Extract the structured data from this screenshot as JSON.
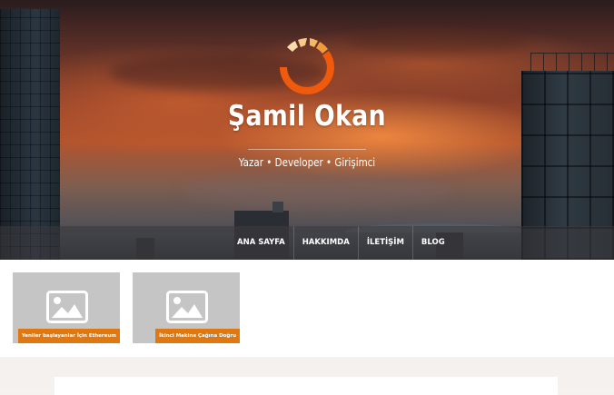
{
  "site": {
    "title": "Şamil Okan",
    "tagline": "Yazar • Developer • Girişimci"
  },
  "nav": {
    "items": [
      {
        "label": "ANA SAYFA"
      },
      {
        "label": "HAKKIMDA"
      },
      {
        "label": "İLETİŞİM"
      },
      {
        "label": "BLOG"
      }
    ]
  },
  "posts": [
    {
      "title": "Yeniler başlayanlar İçin Ethereum"
    },
    {
      "title": "İkinci Makine Çağına Doğru"
    }
  ],
  "colors": {
    "accent": "#e07812",
    "logo_orange": "#f05a0c",
    "logo_light": "#f7c98a",
    "placeholder": "#c5c5c5"
  },
  "icons": {
    "logo": "sunrise-ring-logo",
    "post_image": "image-placeholder-icon"
  }
}
